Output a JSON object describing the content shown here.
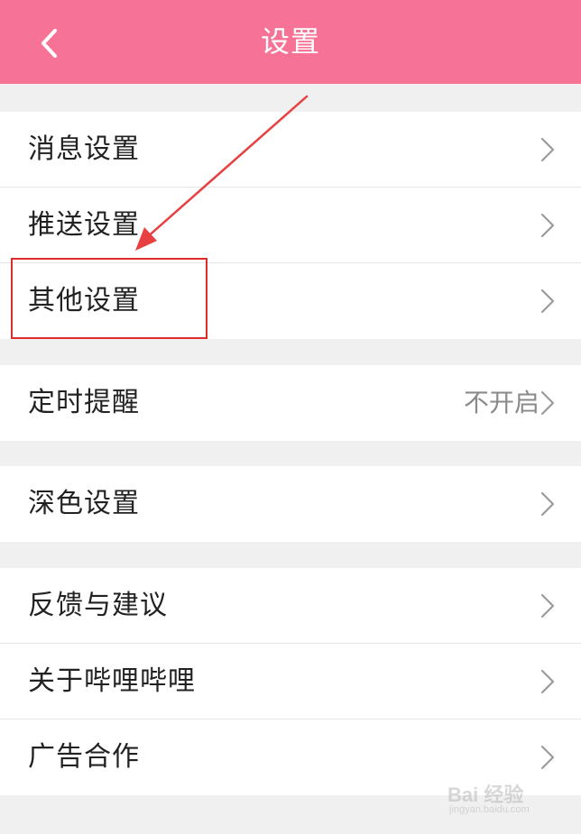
{
  "header": {
    "title": "设置",
    "background": "#f77396",
    "back_icon": "chevron-left-icon"
  },
  "groups": [
    {
      "items": [
        {
          "label": "消息设置",
          "value": ""
        },
        {
          "label": "推送设置",
          "value": ""
        },
        {
          "label": "其他设置",
          "value": ""
        }
      ]
    },
    {
      "items": [
        {
          "label": "定时提醒",
          "value": "不开启"
        }
      ]
    },
    {
      "items": [
        {
          "label": "深色设置",
          "value": ""
        }
      ]
    },
    {
      "items": [
        {
          "label": "反馈与建议",
          "value": ""
        },
        {
          "label": "关于哔哩哔哩",
          "value": ""
        },
        {
          "label": "广告合作",
          "value": ""
        }
      ]
    }
  ],
  "annotation": {
    "highlight_color": "#e02b2b",
    "highlighted_item": "其他设置"
  },
  "watermark": {
    "text": "Bai 经验",
    "subtext": "jingyan.baidu.com"
  }
}
